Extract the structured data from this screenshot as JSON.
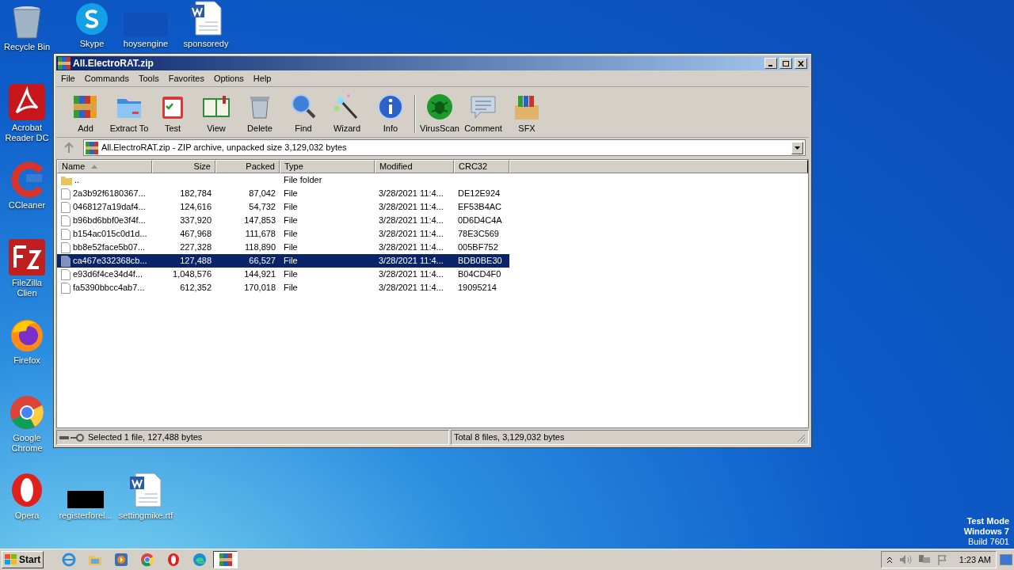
{
  "desktop_icons": [
    {
      "label": "Recycle Bin",
      "kind": "recycle"
    },
    {
      "label": "Skype",
      "kind": "skype"
    },
    {
      "label": "hoysengine",
      "kind": "blank"
    },
    {
      "label": "sponsoredy",
      "kind": "word"
    },
    {
      "label": "Acrobat Reader DC",
      "kind": "acrobat"
    },
    {
      "label": "CCleaner",
      "kind": "ccleaner"
    },
    {
      "label": "FileZilla Clien",
      "kind": "filezilla"
    },
    {
      "label": "Firefox",
      "kind": "firefox"
    },
    {
      "label": "Google Chrome",
      "kind": "chrome"
    },
    {
      "label": "Opera",
      "kind": "opera"
    },
    {
      "label": "registerforel...",
      "kind": "black"
    },
    {
      "label": "settingmike.rtf",
      "kind": "word"
    }
  ],
  "window": {
    "title": "All.ElectroRAT.zip",
    "menu": [
      "File",
      "Commands",
      "Tools",
      "Favorites",
      "Options",
      "Help"
    ],
    "toolbar": [
      {
        "label": "Add",
        "kind": "add"
      },
      {
        "label": "Extract To",
        "kind": "extract"
      },
      {
        "label": "Test",
        "kind": "test"
      },
      {
        "label": "View",
        "kind": "view"
      },
      {
        "label": "Delete",
        "kind": "delete"
      },
      {
        "label": "Find",
        "kind": "find"
      },
      {
        "label": "Wizard",
        "kind": "wizard"
      },
      {
        "label": "Info",
        "kind": "info"
      },
      {
        "label": "VirusScan",
        "kind": "virus"
      },
      {
        "label": "Comment",
        "kind": "comment"
      },
      {
        "label": "SFX",
        "kind": "sfx"
      }
    ],
    "address": "All.ElectroRAT.zip - ZIP archive, unpacked size 3,129,032 bytes",
    "table": {
      "columns": [
        "Name",
        "Size",
        "Packed",
        "Type",
        "Modified",
        "CRC32"
      ],
      "rows": [
        {
          "kind": "folder",
          "name": "..",
          "size": "",
          "packed": "",
          "type": "File folder",
          "modified": "",
          "crc": "",
          "selected": false
        },
        {
          "kind": "file",
          "name": "2a3b92f6180367...",
          "size": "182,784",
          "packed": "87,042",
          "type": "File",
          "modified": "3/28/2021 11:4...",
          "crc": "DE12E924",
          "selected": false
        },
        {
          "kind": "file",
          "name": "0468127a19daf4...",
          "size": "124,616",
          "packed": "54,732",
          "type": "File",
          "modified": "3/28/2021 11:4...",
          "crc": "EF53B4AC",
          "selected": false
        },
        {
          "kind": "file",
          "name": "b96bd6bbf0e3f4f...",
          "size": "337,920",
          "packed": "147,853",
          "type": "File",
          "modified": "3/28/2021 11:4...",
          "crc": "0D6D4C4A",
          "selected": false
        },
        {
          "kind": "file",
          "name": "b154ac015c0d1d...",
          "size": "467,968",
          "packed": "111,678",
          "type": "File",
          "modified": "3/28/2021 11:4...",
          "crc": "78E3C569",
          "selected": false
        },
        {
          "kind": "file",
          "name": "bb8e52face5b07...",
          "size": "227,328",
          "packed": "118,890",
          "type": "File",
          "modified": "3/28/2021 11:4...",
          "crc": "005BF752",
          "selected": false
        },
        {
          "kind": "file",
          "name": "ca467e332368cb...",
          "size": "127,488",
          "packed": "66,527",
          "type": "File",
          "modified": "3/28/2021 11:4...",
          "crc": "BDB0BE30",
          "selected": true
        },
        {
          "kind": "file",
          "name": "e93d6f4ce34d4f...",
          "size": "1,048,576",
          "packed": "144,921",
          "type": "File",
          "modified": "3/28/2021 11:4...",
          "crc": "B04CD4F0",
          "selected": false
        },
        {
          "kind": "file",
          "name": "fa5390bbcc4ab7...",
          "size": "612,352",
          "packed": "170,018",
          "type": "File",
          "modified": "3/28/2021 11:4...",
          "crc": "19095214",
          "selected": false
        }
      ]
    },
    "status_left": "Selected 1 file, 127,488 bytes",
    "status_right": "Total 8 files, 3,129,032 bytes"
  },
  "os_notice": [
    "Test Mode",
    "Windows 7",
    "Build 7601"
  ],
  "taskbar": {
    "start": "Start",
    "apps": [
      {
        "kind": "ie",
        "selected": false
      },
      {
        "kind": "explorer",
        "selected": false
      },
      {
        "kind": "media",
        "selected": false
      },
      {
        "kind": "chrome",
        "selected": false
      },
      {
        "kind": "opera",
        "selected": false
      },
      {
        "kind": "edge",
        "selected": false
      },
      {
        "kind": "winrar",
        "selected": true
      }
    ],
    "clock": "1:23 AM"
  }
}
